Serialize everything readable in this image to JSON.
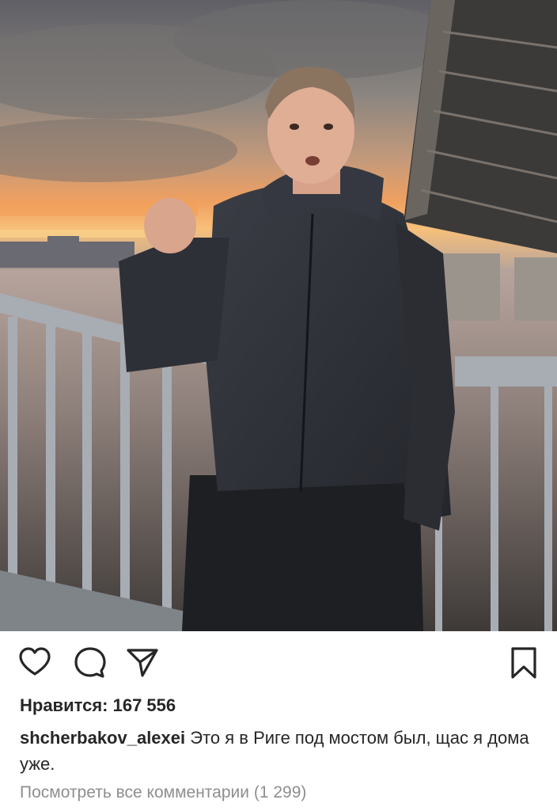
{
  "post": {
    "photo_alt": "Мужчина в тёмной куртке у перил моста на закате",
    "likes_text": "Нравится: 167 556",
    "username": "shcherbakov_alexei",
    "caption": "Это я в Риге под мостом был, щас я дома уже.",
    "view_comments": "Посмотреть все комментарии (1 299)"
  },
  "actions": {
    "like_icon": "heart-icon",
    "comment_icon": "comment-icon",
    "share_icon": "send-icon",
    "save_icon": "bookmark-icon"
  },
  "colors": {
    "text": "#262626",
    "secondary_text": "#8e8e8e",
    "background": "#ffffff"
  }
}
